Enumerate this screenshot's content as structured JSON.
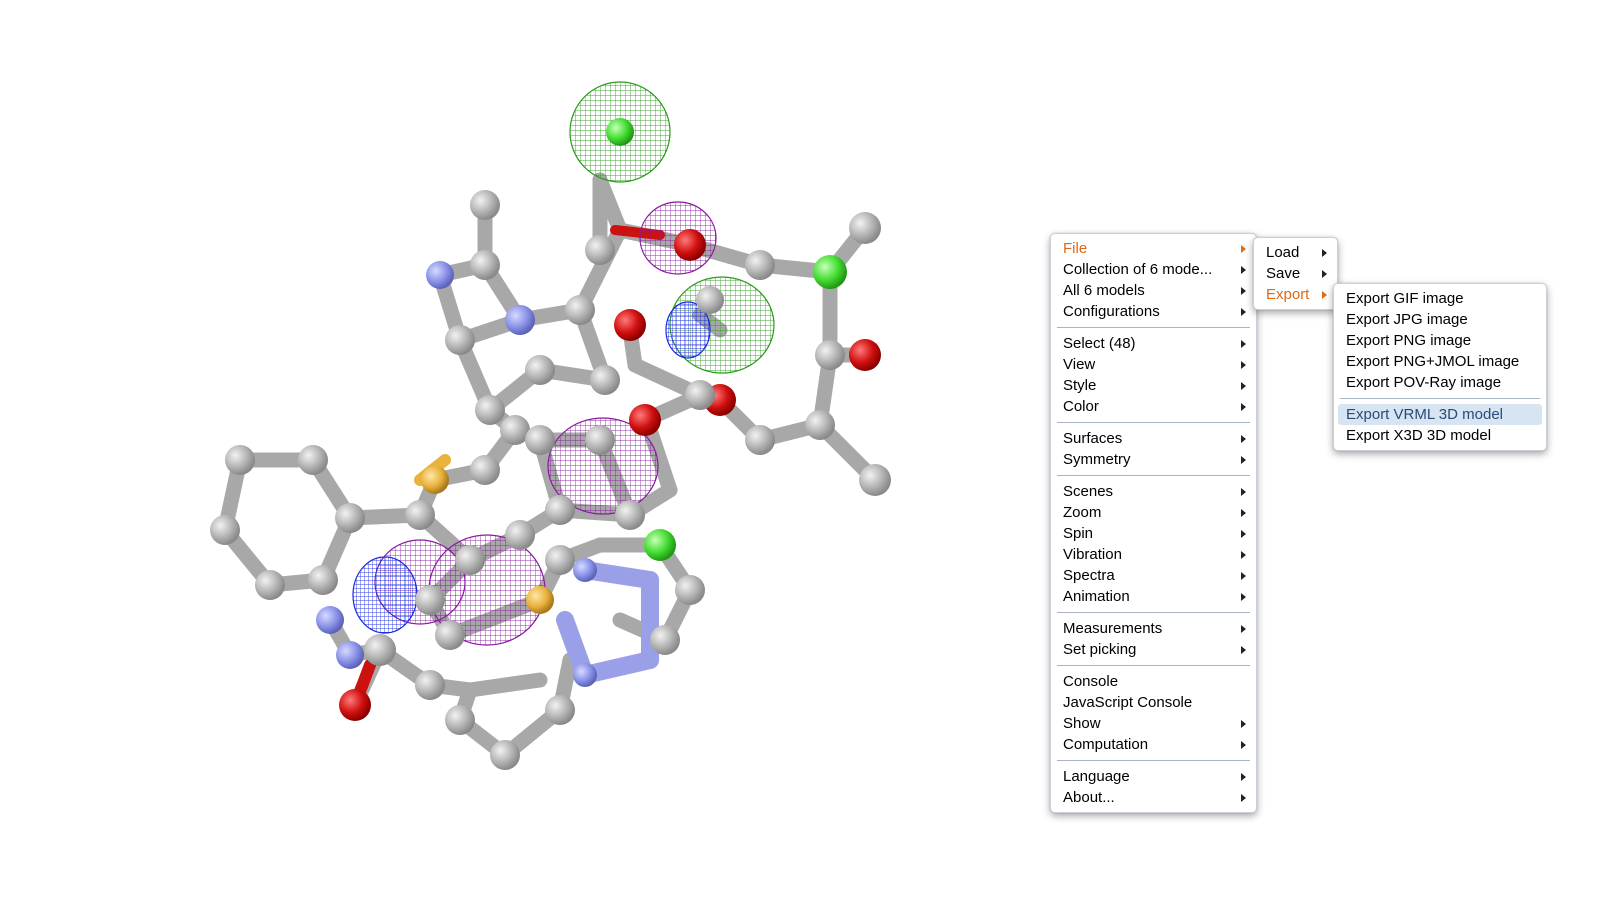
{
  "main_menu": {
    "groups": [
      [
        {
          "label": "File",
          "submenu": true,
          "active": true
        },
        {
          "label": "Collection of 6 mode...",
          "submenu": true
        },
        {
          "label": "All 6 models",
          "submenu": true
        },
        {
          "label": "Configurations",
          "submenu": true
        }
      ],
      [
        {
          "label": "Select (48)",
          "submenu": true
        },
        {
          "label": "View",
          "submenu": true
        },
        {
          "label": "Style",
          "submenu": true
        },
        {
          "label": "Color",
          "submenu": true
        }
      ],
      [
        {
          "label": "Surfaces",
          "submenu": true
        },
        {
          "label": "Symmetry",
          "submenu": true
        }
      ],
      [
        {
          "label": "Scenes",
          "submenu": true
        },
        {
          "label": "Zoom",
          "submenu": true
        },
        {
          "label": "Spin",
          "submenu": true
        },
        {
          "label": "Vibration",
          "submenu": true
        },
        {
          "label": "Spectra",
          "submenu": true
        },
        {
          "label": "Animation",
          "submenu": true
        }
      ],
      [
        {
          "label": "Measurements",
          "submenu": true
        },
        {
          "label": "Set picking",
          "submenu": true
        }
      ],
      [
        {
          "label": "Console",
          "submenu": false
        },
        {
          "label": "JavaScript Console",
          "submenu": false
        },
        {
          "label": "Show",
          "submenu": true
        },
        {
          "label": "Computation",
          "submenu": true
        }
      ],
      [
        {
          "label": "Language",
          "submenu": true
        },
        {
          "label": "About...",
          "submenu": true
        }
      ]
    ]
  },
  "file_menu": {
    "items": [
      {
        "label": "Load",
        "submenu": true
      },
      {
        "label": "Save",
        "submenu": true
      },
      {
        "label": "Export",
        "submenu": true,
        "active": true
      }
    ]
  },
  "export_menu": {
    "groups": [
      [
        {
          "label": "Export GIF image"
        },
        {
          "label": "Export JPG image"
        },
        {
          "label": "Export PNG image"
        },
        {
          "label": "Export PNG+JMOL image"
        },
        {
          "label": "Export POV-Ray image"
        }
      ],
      [
        {
          "label": "Export VRML 3D model",
          "highlight": true
        },
        {
          "label": "Export X3D 3D model"
        }
      ]
    ]
  },
  "colors": {
    "active_text": "#e06a14",
    "highlight_bg": "#d7e4f2",
    "carbon": "#a9a9a9",
    "nitrogen": "#8a93e8",
    "oxygen": "#cc1111",
    "chlorine": "#44dd33",
    "sulfur": "#e8b23c",
    "mesh_green": "#2a9a1a",
    "mesh_purple": "#8a1aa0",
    "mesh_blue": "#1a2ae0"
  }
}
